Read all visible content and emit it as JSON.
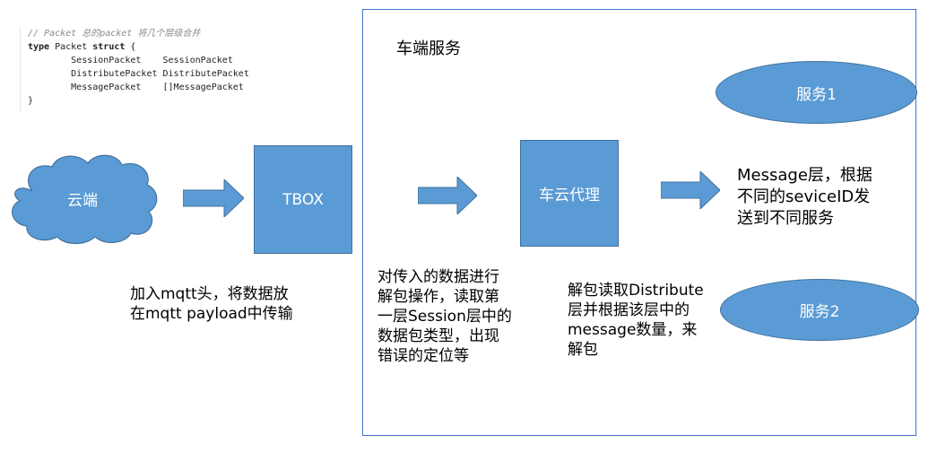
{
  "code": {
    "comment": "// Packet 总的packet 将几个层级合并",
    "line1_kw": "type",
    "line1_rest": " Packet ",
    "line1_kw2": "struct",
    "line1_end": " {",
    "line2": "        SessionPacket    SessionPacket",
    "line3": "        DistributePacket DistributePacket",
    "line4": "        MessagePacket    []MessagePacket",
    "line5": "}"
  },
  "frame_title": "车端服务",
  "nodes": {
    "cloud": "云端",
    "tbox": "TBOX",
    "proxy": "车云代理",
    "service1": "服务1",
    "service2": "服务2"
  },
  "texts": {
    "mqtt_line1": "加入mqtt头，将数据放",
    "mqtt_line2": "在mqtt payload中传输",
    "parse_line1": "对传入的数据进行",
    "parse_line2": "解包操作，读取第",
    "parse_line3": "一层Session层中的",
    "parse_line4": "数据包类型，出现",
    "parse_line5": "错误的定位等",
    "dist_line1": "解包读取Distribute",
    "dist_line2": "层并根据该层中的",
    "dist_line3": "message数量，来",
    "dist_line4": "解包",
    "msg_line1": "Message层，根据",
    "msg_line2": "不同的seviceID发",
    "msg_line3": "送到不同服务"
  },
  "colors": {
    "node_fill": "#5b9bd5",
    "node_border": "#41719c",
    "frame_border": "#4472c4"
  }
}
